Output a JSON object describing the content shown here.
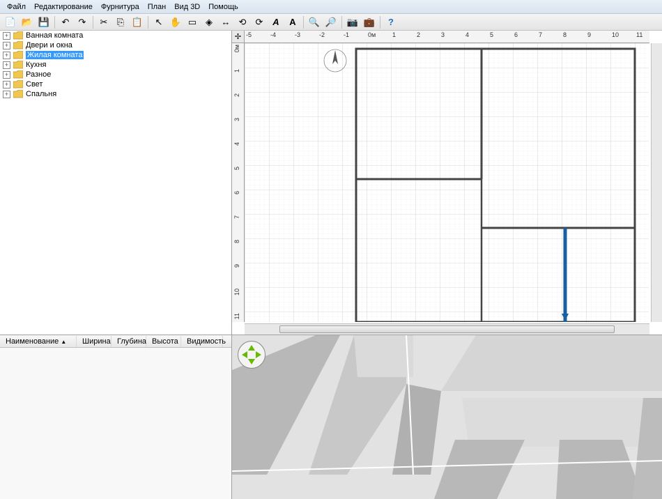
{
  "menu": {
    "file": "Файл",
    "edit": "Редактирование",
    "furniture": "Фурнитура",
    "plan": "План",
    "view3d": "Вид 3D",
    "help": "Помощь"
  },
  "tree": {
    "items": [
      {
        "label": "Ванная комната"
      },
      {
        "label": "Двери и окна"
      },
      {
        "label": "Жилая комната",
        "selected": true
      },
      {
        "label": "Кухня"
      },
      {
        "label": "Разное"
      },
      {
        "label": "Свет"
      },
      {
        "label": "Спальня"
      }
    ]
  },
  "table": {
    "columns": {
      "name": "Наименование",
      "width": "Ширина",
      "depth": "Глубина",
      "height": "Высота",
      "visibility": "Видимость"
    },
    "sort_indicator": "▲"
  },
  "plan": {
    "ruler_unit_zero": "0м",
    "ruler_x": [
      -5,
      -4,
      -3,
      -2,
      -1,
      "0м",
      1,
      2,
      3,
      4,
      5,
      6,
      7,
      8,
      9,
      10,
      11
    ],
    "ruler_y": [
      "0м",
      1,
      2,
      3,
      4,
      5,
      6,
      7,
      8,
      9,
      10,
      11
    ]
  },
  "colors": {
    "selection": "#3399ff",
    "grid_minor": "#e8e8e8",
    "grid_major": "#c8c8c8",
    "wall": "#555",
    "highlight_wall": "#1860a0"
  }
}
